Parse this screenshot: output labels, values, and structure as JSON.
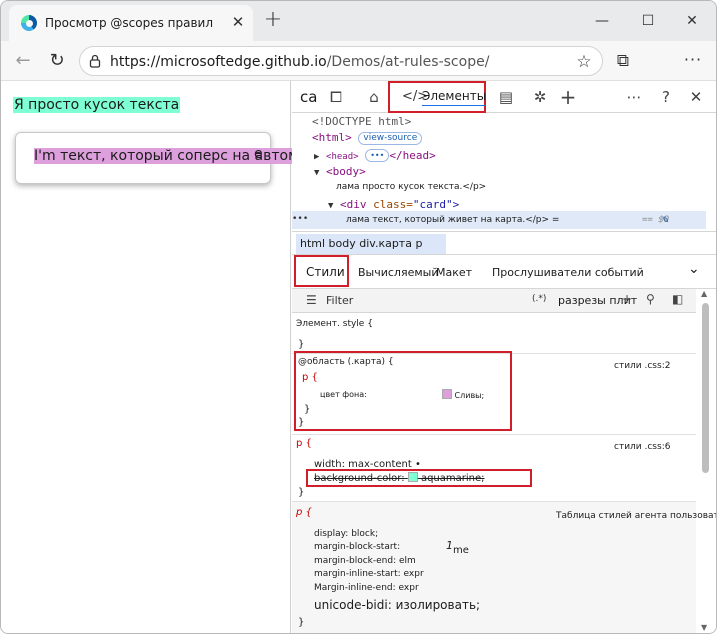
{
  "browser": {
    "tab_title": "Просмотр @scopes правил",
    "url_host": "microsoftedge.github.io",
    "url_prefix": "https://",
    "url_path": "/Demos/at-rules-scope/"
  },
  "page": {
    "plain_text": "Я просто кусок текста",
    "card_text": "I'm текст, который соперс на автомобиле",
    "card_overflow": "e"
  },
  "devtools": {
    "toolbar_ca": "ca",
    "elements_code": "</>",
    "elements_label": "Элементы",
    "dom": {
      "doctype": "<!DOCTYPE html>",
      "html_open": "<html>",
      "view_source": "view-source",
      "head": "<head>",
      "head_ellipsis": "•••",
      "head_close": "</head>",
      "body": "<body>",
      "p1": "лама просто кусок текста.</p>",
      "div_open": "<div",
      "div_attr": "class=",
      "div_val": "\"card\">",
      "p2": "лама текст, который живет на карта.</p> =",
      "dollar": "== $0"
    },
    "breadcrumb": "html body div.карта p",
    "sub_tabs": {
      "styles": "Стили",
      "computed": "Вычисляемый",
      "layout": "Макет",
      "listeners": "Прослушиватели событий"
    },
    "filter": {
      "label": "Filter",
      "cls": "(.*)",
      "cut": "разрезы плит"
    },
    "styles": {
      "element_style": "Элемент. style {",
      "close": "}",
      "scope_rule": "@область (.карта) {",
      "scope_src": "стили .css:2",
      "p_sel": "p {",
      "bg_prop": "цвет фона:",
      "bg_val": "Сливы;",
      "p_src": "стили .css:6",
      "width_decl": "width: max-content •",
      "strike_decl": "background-color:",
      "strike_val": "aquamarine;",
      "ua_label": "Таблица стилей агента пользователя",
      "display": "display: block;",
      "mbs": "margin-block-start:",
      "mbs_val": "1",
      "mbs_unit": "me",
      "mbe": "margin-block-end: elm",
      "mis": "margin-inline-start: expr",
      "mie": "Margin-inline-end: expr",
      "unicode": "unicode-bidi: изолировать;"
    }
  },
  "colors": {
    "aquamarine": "#7fffd4",
    "plum": "#dda0dd",
    "highlight_red": "#d11e2b"
  }
}
